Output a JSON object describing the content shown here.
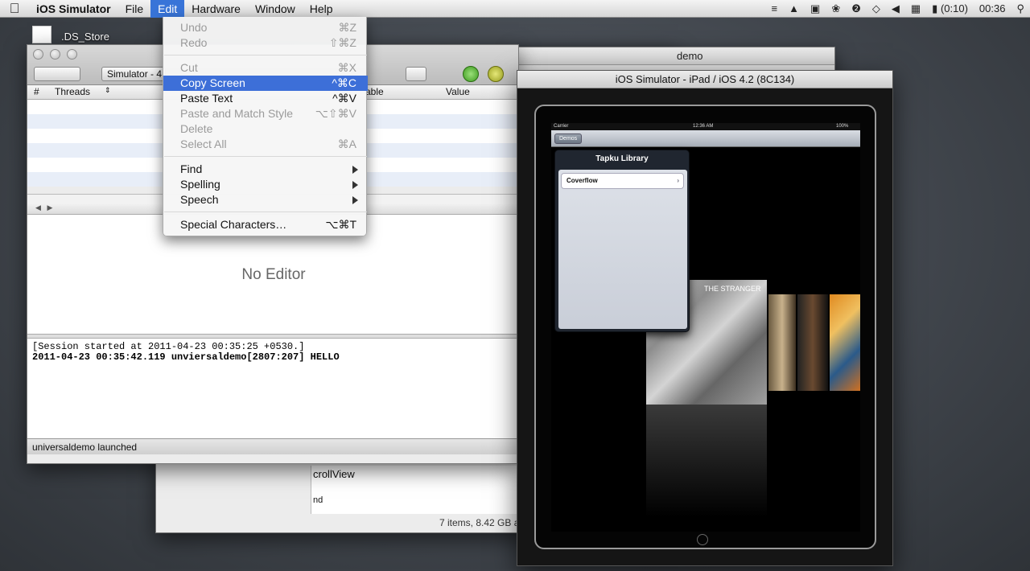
{
  "menubar": {
    "app": "iOS Simulator",
    "items": [
      "File",
      "Edit",
      "Hardware",
      "Window",
      "Help"
    ],
    "battery": "(0:10)",
    "clock": "00:36"
  },
  "desktop": {
    "icon_label": ".DS_Store"
  },
  "edit_menu": {
    "items": [
      {
        "label": "Undo",
        "shortcut": "⌘Z"
      },
      {
        "label": "Redo",
        "shortcut": "⇧⌘Z"
      },
      {
        "label": "Cut",
        "shortcut": "⌘X"
      },
      {
        "label": "Copy Screen",
        "shortcut": "^⌘C"
      },
      {
        "label": "Paste Text",
        "shortcut": "^⌘V"
      },
      {
        "label": "Paste and Match Style",
        "shortcut": "⌥⇧⌘V"
      },
      {
        "label": "Delete",
        "shortcut": ""
      },
      {
        "label": "Select All",
        "shortcut": "⌘A"
      },
      {
        "label": "Find",
        "shortcut": ""
      },
      {
        "label": "Spelling",
        "shortcut": ""
      },
      {
        "label": "Speech",
        "shortcut": ""
      },
      {
        "label": "Special Characters…",
        "shortcut": "⌥⌘T"
      }
    ]
  },
  "xcode": {
    "title_fragment": "demo",
    "scheme": "Simulator - 4",
    "columns": {
      "num": "#",
      "threads": "Threads",
      "variable_fragment": "able",
      "value": "Value"
    },
    "no_editor": "No Editor",
    "console": [
      "[Session started at 2011-04-23 00:35:25 +0530.]",
      "2011-04-23 00:35:42.119 unviersaldemo[2807:207] HELLO"
    ],
    "status": "universaldemo launched"
  },
  "back_window": {
    "title_fragment": "demo",
    "list_item": "crollView",
    "list_item2": "nd",
    "footer": "7 items, 8.42 GB a"
  },
  "simulator": {
    "title": "iOS Simulator - iPad / iOS 4.2 (8C134)",
    "status_carrier": "Carrier",
    "status_time": "12:36 AM",
    "status_battery": "100%",
    "nav_button": "Demos",
    "popover_title": "Tapku Library",
    "popover_cell": "Coverflow",
    "album_text": "THE STRANGER"
  }
}
